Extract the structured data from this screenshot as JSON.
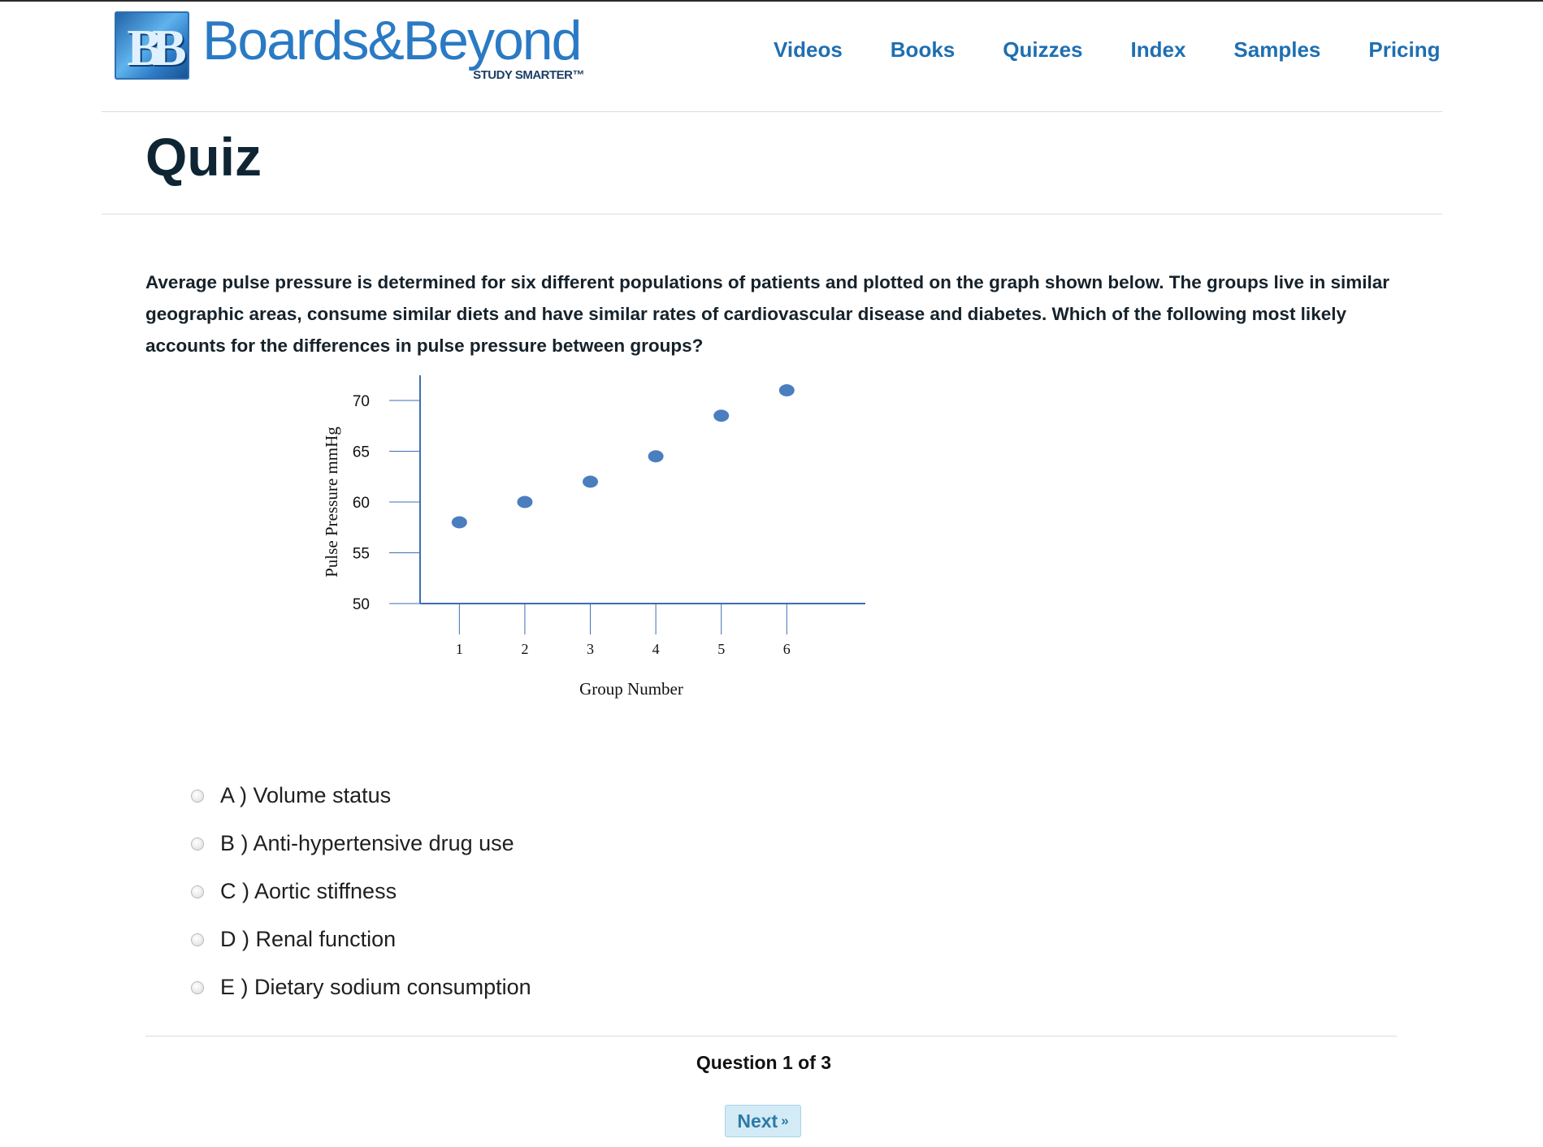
{
  "header": {
    "logo": {
      "mark": "BB",
      "name": "Boards&Beyond",
      "tagline": "STUDY SMARTER™"
    },
    "nav": [
      "Videos",
      "Books",
      "Quizzes",
      "Index",
      "Samples",
      "Pricing"
    ]
  },
  "page": {
    "title": "Quiz"
  },
  "question": {
    "text": "Average pulse pressure is determined for six different populations of patients and plotted on the graph shown below.  The groups live in similar geographic areas, consume similar diets and have similar rates of cardiovascular disease and diabetes. Which of the following most likely accounts for the differences in pulse pressure between groups?"
  },
  "chart_data": {
    "type": "scatter",
    "title": "",
    "xlabel": "Group Number",
    "ylabel": "Pulse Pressure mmHg",
    "x": [
      1,
      2,
      3,
      4,
      5,
      6
    ],
    "y": [
      58,
      60,
      62,
      64.5,
      68.5,
      71
    ],
    "xticks": [
      "1",
      "2",
      "3",
      "4",
      "5",
      "6"
    ],
    "yticks": [
      "50",
      "55",
      "60",
      "65",
      "70"
    ],
    "ylim": [
      50,
      72
    ],
    "xlim": [
      0.4,
      7.2
    ],
    "grid": false,
    "marker_color": "#4a7ebf",
    "axis_color": "#3b6fb0"
  },
  "options": [
    {
      "letter": "A",
      "label": "A ) Volume status"
    },
    {
      "letter": "B",
      "label": "B ) Anti-hypertensive drug use"
    },
    {
      "letter": "C",
      "label": "C ) Aortic stiffness"
    },
    {
      "letter": "D",
      "label": "D ) Renal function"
    },
    {
      "letter": "E",
      "label": "E ) Dietary sodium consumption"
    }
  ],
  "footer": {
    "counter": "Question 1 of 3",
    "next_label": "Next",
    "next_arrow": "»"
  }
}
